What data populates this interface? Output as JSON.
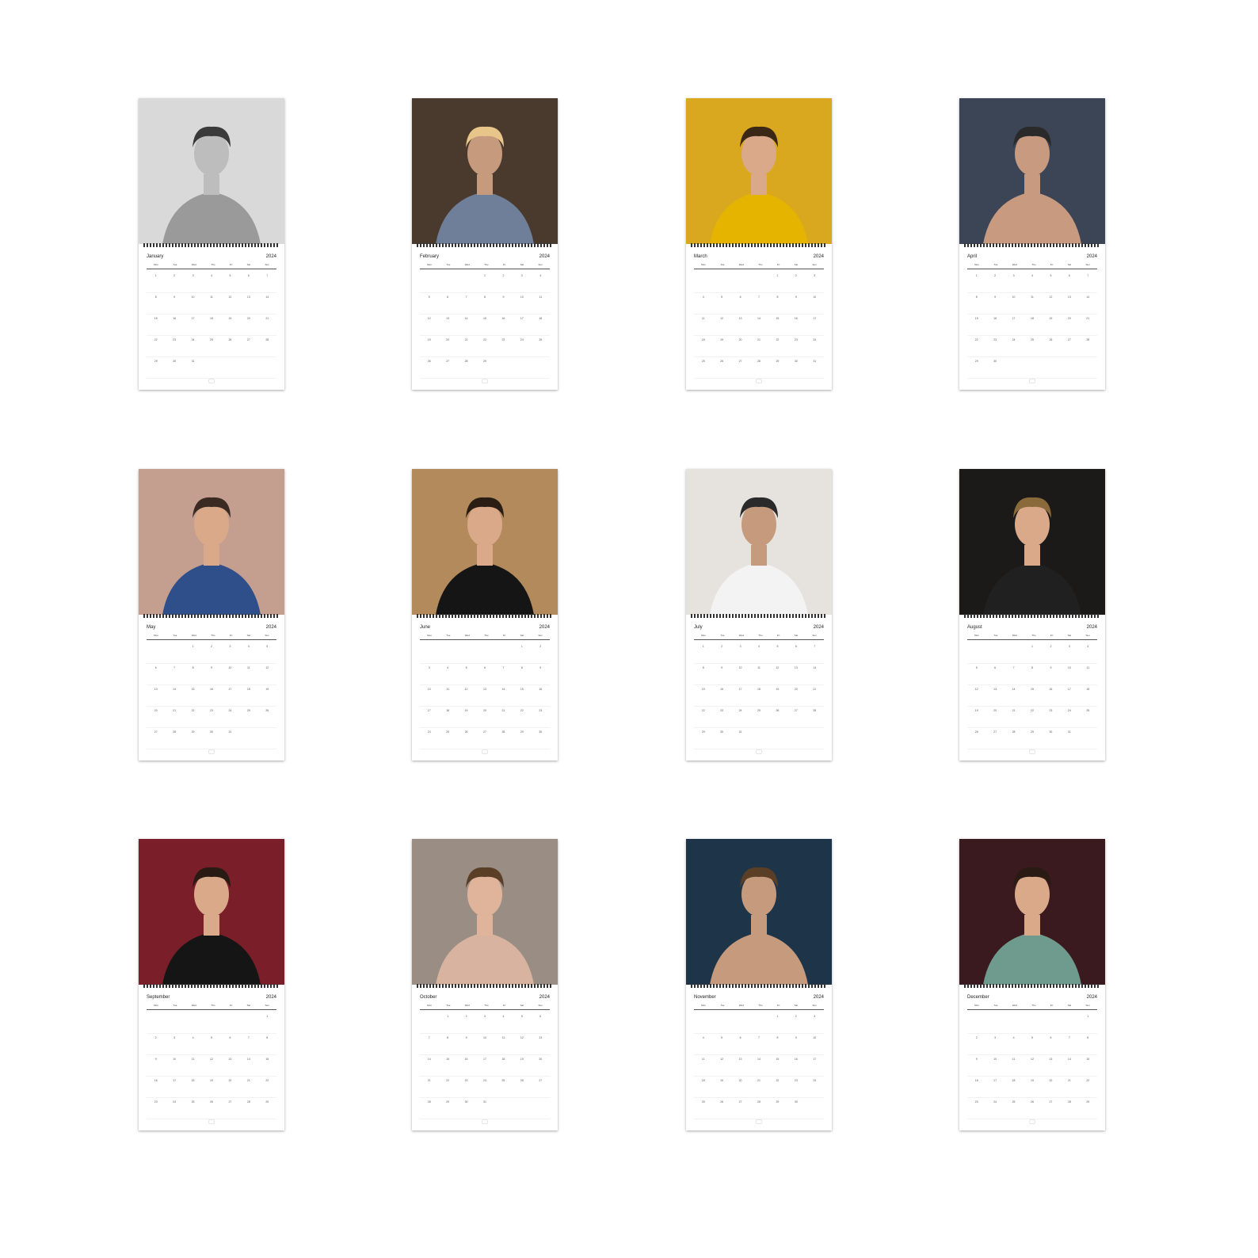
{
  "year": "2024",
  "weekdays": [
    "Mon",
    "Tue",
    "Wed",
    "Thu",
    "Fri",
    "Sat",
    "Sun"
  ],
  "months": [
    {
      "name": "January",
      "photo": {
        "bg": "#d9d9d9",
        "accent": "#3a3a3a",
        "skin": "#bdbdbd",
        "shirt": "#9a9a9a"
      }
    },
    {
      "name": "February",
      "photo": {
        "bg": "#4a3a2e",
        "accent": "#e8c68a",
        "skin": "#c69a7c",
        "shirt": "#6f7f99"
      }
    },
    {
      "name": "March",
      "photo": {
        "bg": "#d9a81e",
        "accent": "#3a2716",
        "skin": "#d9a98a",
        "shirt": "#e5b400"
      }
    },
    {
      "name": "April",
      "photo": {
        "bg": "#3c4555",
        "accent": "#2a2a2a",
        "skin": "#c89a80",
        "shirt": "#c89a80"
      }
    },
    {
      "name": "May",
      "photo": {
        "bg": "#c49e8e",
        "accent": "#3a2a22",
        "skin": "#d9a98a",
        "shirt": "#2e4f8a"
      }
    },
    {
      "name": "June",
      "photo": {
        "bg": "#b38a5c",
        "accent": "#2a1d14",
        "skin": "#d9a98a",
        "shirt": "#151515"
      }
    },
    {
      "name": "July",
      "photo": {
        "bg": "#e6e3df",
        "accent": "#2a2a2a",
        "skin": "#c69a7c",
        "shirt": "#f3f3f3"
      }
    },
    {
      "name": "August",
      "photo": {
        "bg": "#1c1a18",
        "accent": "#8a6a3a",
        "skin": "#d9a98a",
        "shirt": "#202020"
      }
    },
    {
      "name": "September",
      "photo": {
        "bg": "#7a1e2a",
        "accent": "#2a1a14",
        "skin": "#d9a98a",
        "shirt": "#151515"
      }
    },
    {
      "name": "October",
      "photo": {
        "bg": "#9a8e84",
        "accent": "#5a3e26",
        "skin": "#e0b49a",
        "shirt": "#d8b4a0"
      }
    },
    {
      "name": "November",
      "photo": {
        "bg": "#1e3448",
        "accent": "#5a3e26",
        "skin": "#c69a7c",
        "shirt": "#c69a7c"
      }
    },
    {
      "name": "December",
      "photo": {
        "bg": "#3a1a1e",
        "accent": "#2a1a14",
        "skin": "#d9a98a",
        "shirt": "#6f9a8e"
      }
    }
  ],
  "days": {
    "January": [
      "1",
      "2",
      "3",
      "4",
      "5",
      "6",
      "7",
      "8",
      "9",
      "10",
      "11",
      "12",
      "13",
      "14",
      "15",
      "16",
      "17",
      "18",
      "19",
      "20",
      "21",
      "22",
      "23",
      "24",
      "25",
      "26",
      "27",
      "28",
      "29",
      "30",
      "31",
      "",
      "",
      "",
      ""
    ],
    "February": [
      "",
      "",
      "",
      "1",
      "2",
      "3",
      "4",
      "5",
      "6",
      "7",
      "8",
      "9",
      "10",
      "11",
      "12",
      "13",
      "14",
      "15",
      "16",
      "17",
      "18",
      "19",
      "20",
      "21",
      "22",
      "23",
      "24",
      "25",
      "26",
      "27",
      "28",
      "29",
      "",
      "",
      ""
    ],
    "March": [
      "",
      "",
      "",
      "",
      "1",
      "2",
      "3",
      "4",
      "5",
      "6",
      "7",
      "8",
      "9",
      "10",
      "11",
      "12",
      "13",
      "14",
      "15",
      "16",
      "17",
      "18",
      "19",
      "20",
      "21",
      "22",
      "23",
      "24",
      "25",
      "26",
      "27",
      "28",
      "29",
      "30",
      "31"
    ],
    "April": [
      "1",
      "2",
      "3",
      "4",
      "5",
      "6",
      "7",
      "8",
      "9",
      "10",
      "11",
      "12",
      "13",
      "14",
      "15",
      "16",
      "17",
      "18",
      "19",
      "20",
      "21",
      "22",
      "23",
      "24",
      "25",
      "26",
      "27",
      "28",
      "29",
      "30",
      "",
      "",
      "",
      "",
      ""
    ],
    "May": [
      "",
      "",
      "1",
      "2",
      "3",
      "4",
      "5",
      "6",
      "7",
      "8",
      "9",
      "10",
      "11",
      "12",
      "13",
      "14",
      "15",
      "16",
      "17",
      "18",
      "19",
      "20",
      "21",
      "22",
      "23",
      "24",
      "25",
      "26",
      "27",
      "28",
      "29",
      "30",
      "31",
      "",
      ""
    ],
    "June": [
      "",
      "",
      "",
      "",
      "",
      "1",
      "2",
      "3",
      "4",
      "5",
      "6",
      "7",
      "8",
      "9",
      "10",
      "11",
      "12",
      "13",
      "14",
      "15",
      "16",
      "17",
      "18",
      "19",
      "20",
      "21",
      "22",
      "23",
      "24",
      "25",
      "26",
      "27",
      "28",
      "29",
      "30"
    ],
    "July": [
      "1",
      "2",
      "3",
      "4",
      "5",
      "6",
      "7",
      "8",
      "9",
      "10",
      "11",
      "12",
      "13",
      "14",
      "15",
      "16",
      "17",
      "18",
      "19",
      "20",
      "21",
      "22",
      "23",
      "24",
      "25",
      "26",
      "27",
      "28",
      "29",
      "30",
      "31",
      "",
      "",
      "",
      ""
    ],
    "August": [
      "",
      "",
      "",
      "1",
      "2",
      "3",
      "4",
      "5",
      "6",
      "7",
      "8",
      "9",
      "10",
      "11",
      "12",
      "13",
      "14",
      "15",
      "16",
      "17",
      "18",
      "19",
      "20",
      "21",
      "22",
      "23",
      "24",
      "25",
      "26",
      "27",
      "28",
      "29",
      "30",
      "31",
      ""
    ],
    "September": [
      "",
      "",
      "",
      "",
      "",
      "",
      "1",
      "2",
      "3",
      "4",
      "5",
      "6",
      "7",
      "8",
      "9",
      "10",
      "11",
      "12",
      "13",
      "14",
      "15",
      "16",
      "17",
      "18",
      "19",
      "20",
      "21",
      "22",
      "23",
      "24",
      "25",
      "26",
      "27",
      "28",
      "29"
    ],
    "October": [
      "",
      "1",
      "2",
      "3",
      "4",
      "5",
      "6",
      "7",
      "8",
      "9",
      "10",
      "11",
      "12",
      "13",
      "14",
      "15",
      "16",
      "17",
      "18",
      "19",
      "20",
      "21",
      "22",
      "23",
      "24",
      "25",
      "26",
      "27",
      "28",
      "29",
      "30",
      "31",
      "",
      "",
      ""
    ],
    "November": [
      "",
      "",
      "",
      "",
      "1",
      "2",
      "3",
      "4",
      "5",
      "6",
      "7",
      "8",
      "9",
      "10",
      "11",
      "12",
      "13",
      "14",
      "15",
      "16",
      "17",
      "18",
      "19",
      "20",
      "21",
      "22",
      "23",
      "24",
      "25",
      "26",
      "27",
      "28",
      "29",
      "30",
      ""
    ],
    "December": [
      "",
      "",
      "",
      "",
      "",
      "",
      "1",
      "2",
      "3",
      "4",
      "5",
      "6",
      "7",
      "8",
      "9",
      "10",
      "11",
      "12",
      "13",
      "14",
      "15",
      "16",
      "17",
      "18",
      "19",
      "20",
      "21",
      "22",
      "23",
      "24",
      "25",
      "26",
      "27",
      "28",
      "29"
    ]
  }
}
